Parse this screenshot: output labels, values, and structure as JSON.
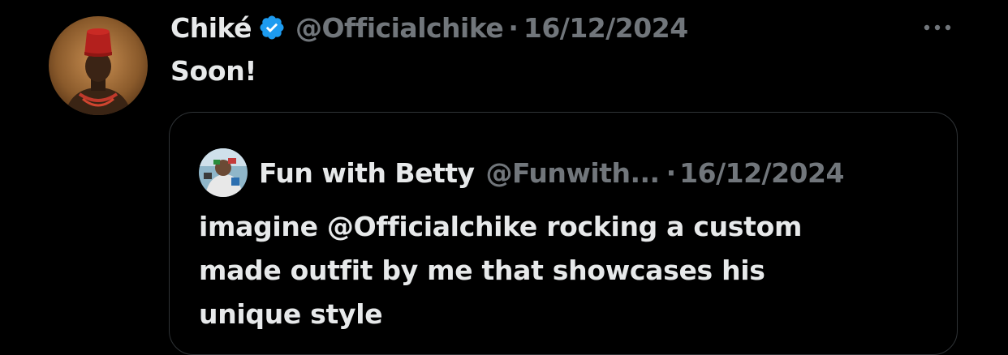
{
  "post": {
    "author": {
      "display_name": "Chiké",
      "handle": "@Officialchike",
      "verified": true,
      "avatar_icon": "avatar-photo-red-fez"
    },
    "separator": "·",
    "date": "16/12/2024",
    "more_icon": "ellipsis-icon",
    "text": "Soon!"
  },
  "quoted_post": {
    "author": {
      "display_name": "Fun with Betty",
      "handle": "@Funwith...",
      "avatar_icon": "avatar-photo"
    },
    "separator": "·",
    "date": "16/12/2024",
    "text_lines": [
      "imagine @Officialchike rocking a custom",
      "made outfit by me that showcases his",
      "unique style"
    ]
  },
  "colors": {
    "background": "#000000",
    "primary_text": "#e7e9ea",
    "secondary_text": "#71767b",
    "verified_badge": "#1d9bf0",
    "quote_border": "#2f3336"
  }
}
